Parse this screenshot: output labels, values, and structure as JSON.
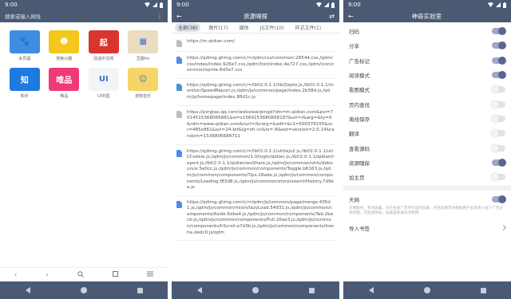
{
  "status": {
    "time": "9:00"
  },
  "screen1": {
    "search_placeholder": "搜索或输入网址",
    "apps": [
      {
        "label": "会员福",
        "color": "#3d8de0",
        "glyph": "🐾"
      },
      {
        "label": "搜索兴趣",
        "color": "#f3c81b",
        "glyph": "☻"
      },
      {
        "label": "凯迪中文网",
        "color": "#d9352f",
        "glyph": "起"
      },
      {
        "label": "豆瓣fm",
        "color": "#e9dcc0",
        "glyph": "▦"
      },
      {
        "label": "知乎",
        "color": "#1f7ae0",
        "glyph": "知"
      },
      {
        "label": "唯品",
        "color": "#ef3a7a",
        "glyph": "唯品"
      },
      {
        "label": "UI中国",
        "color": "#f2f5f8",
        "glyph": "UI"
      },
      {
        "label": "搜狗音乐",
        "color": "#f4d56a",
        "glyph": "☺"
      }
    ],
    "bottom_icons": [
      "back-icon",
      "forward-icon",
      "search-icon",
      "tabs-icon",
      "menu-icon"
    ]
  },
  "screen2": {
    "title": "资源嗅探",
    "tabs": [
      "全部(38)",
      "图片(17)",
      "媒体",
      "JS文件(10)",
      "样式文件(1)"
    ],
    "resources": [
      {
        "type": "gray",
        "url": "https://m.qidian.com/"
      },
      {
        "type": "blue",
        "url": "https://qdimg.gtimg.com/c/=/qdm/css/common/.26544.css,/qdm/css/index/index.926e7.css,/qdm/font/index.4e727.css,/qdm/icon/common/sprite.8d3e7.css"
      },
      {
        "type": "blue",
        "url": "https://qdimg.gtimg.com/c/=/lbf/2.0.1.1/lib/Zepto.js,/lbf/2.0.1.1/monitor/SpeedReport.js,/qdm/js/common/page/index.2b38d.js,/qdm/js/homepage/index.88d1c.js"
      },
      {
        "type": "gray",
        "url": "https://pingtas.qq.com/webview/pingd?dm=m.qidian.com&pvi=7014515368066881&si=s1564153680668187&url=/&arg=&ty=0&rdm=www.qidian.com&rurl=/&rarg=&adt=&r2=500376155&scr=485x861&scl=24-bit&lg=zh-cn&tz=-8&ext=version=2.0.14&random=1536806688711"
      },
      {
        "type": "blue",
        "url": "https://qdimg.gtimg.com/c/=/lbf/2.0.1.1/util/ejs2.js,/lbf/2.0.1.1/util/Cookie.js,/qdm/js/common/1.0/login/qidian.js,/lbf/2.0.1.1/qidian/report.js,/lbf/2.0.1.1/qidian/wxShare.js,/qdm/js/common/utils/debounce.5e0cc.js,/qdm/js/common/components/Toggle.b6163.js,/qdm/js/common/components/Tips.28ade.js,/qdm/js/common/components/Loading.f83d8.js,/qdm/js/common/store/searchHistory.7d9ea.js"
      },
      {
        "type": "blue",
        "url": "https://qdimg.gtimg.com/c/=/qdm/js/common/page/merge.435d1.js,/qdm/js/common/mixin/lazyLoad.54931.js,/qdm/js/common/components/Aside.6dba4.js,/qdm/js/common/components/Tab.2becb.js,/qdm/js/common/components/Pull.20ae3.js,/qdm/js/common/components/hScroll.a7d3b.js,/qdm/js/common/components/Inertia.dedc0.js/qdm"
      }
    ]
  },
  "screen3": {
    "title": "神奇实验室",
    "toggles": [
      {
        "label": "扫码",
        "on": true
      },
      {
        "label": "分享",
        "on": true
      },
      {
        "label": "广告标记",
        "on": true
      },
      {
        "label": "阅读模式",
        "on": true
      },
      {
        "label": "看图模式",
        "on": false
      },
      {
        "label": "页内查找",
        "on": false
      },
      {
        "label": "离线保存",
        "on": false
      },
      {
        "label": "翻译",
        "on": false
      },
      {
        "label": "查看源码",
        "on": false
      },
      {
        "label": "资源嗅探",
        "on": true
      },
      {
        "label": "加主页",
        "on": false
      }
    ],
    "tianwang": {
      "label": "天网",
      "on": true,
      "desc": "天网服务，有效屏蔽。对于由多广告所引起的加载，开启后网页将根据用户名单进入给了广告过滤页面，可能会降低。加速容易被访问错用。"
    },
    "import_label": "导入书签"
  }
}
